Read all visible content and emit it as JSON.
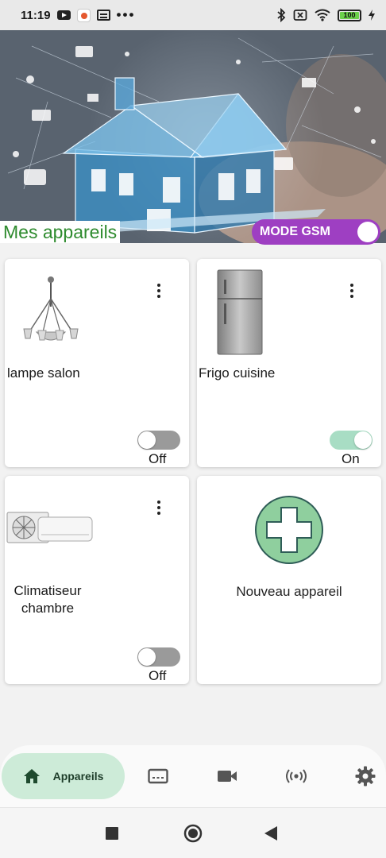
{
  "status_bar": {
    "time": "11:19",
    "battery_level": "100",
    "icons": [
      "youtube-icon",
      "app-icon",
      "news-icon",
      "more-dots-icon",
      "bluetooth-icon",
      "sim-off-icon",
      "wifi-icon",
      "battery-icon",
      "charging-icon"
    ]
  },
  "banner": {
    "title": "Mes appareils",
    "gsm_mode_label": "MODE GSM",
    "gsm_mode_on": true
  },
  "devices": [
    {
      "name": "lampe salon",
      "state_label": "Off",
      "on": false,
      "image": "chandelier"
    },
    {
      "name": "Frigo cuisine",
      "state_label": "On",
      "on": true,
      "image": "fridge"
    },
    {
      "name": "Climatiseur\nchambre",
      "state_label": "Off",
      "on": false,
      "image": "air-conditioner"
    }
  ],
  "new_device": {
    "label": "Nouveau appareil"
  },
  "bottom_nav": {
    "active_label": "Appareils",
    "items": [
      "home-icon",
      "message-icon",
      "camera-icon",
      "broadcast-icon",
      "settings-icon"
    ]
  },
  "colors": {
    "title_green": "#2e8b2e",
    "gsm_purple": "#9e3fc2",
    "switch_on": "#a8ddc4",
    "nav_active": "#cdebd8",
    "add_green": "#8fcf9e"
  }
}
